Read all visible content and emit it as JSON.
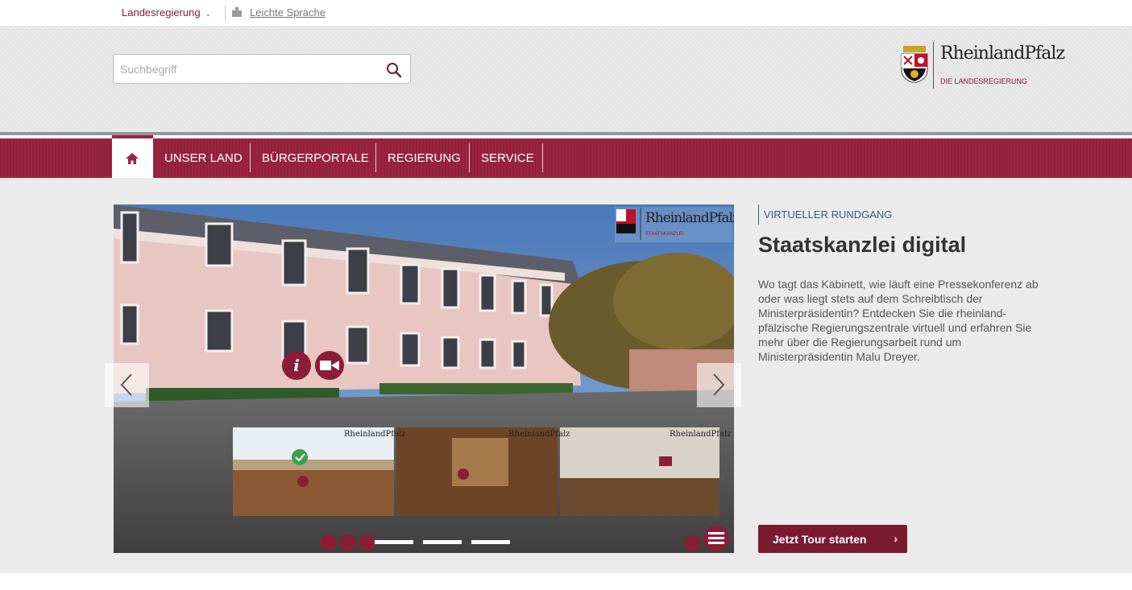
{
  "topbar": {
    "landesregierung_label": "Landesregierung",
    "leichte_sprache_label": "Leichte Sprache"
  },
  "search": {
    "placeholder": "Suchbegriff"
  },
  "logo": {
    "name": "RheinlandPfalz",
    "subtitle": "DIE LANDESREGIERUNG"
  },
  "nav": {
    "items": [
      {
        "label": "UNSER LAND"
      },
      {
        "label": "BÜRGERPORTALE"
      },
      {
        "label": "REGIERUNG"
      },
      {
        "label": "SERVICE"
      }
    ]
  },
  "slider": {
    "image_logo_name": "RheinlandPfalz",
    "image_logo_sub": "STAATSKANZLEI",
    "thumb_logo": "RheinlandPfalz",
    "active_indicator": 0
  },
  "feature": {
    "category": "VIRTUELLER RUNDGANG",
    "title": "Staatskanzlei digital",
    "text": "Wo tagt das Kabinett, wie läuft eine Pressekonferenz ab oder was liegt stets auf dem Schreibtisch der Ministerpräsidentin? Entdecken Sie die rheinland-pfälzische Regierungszentrale virtuell und erfahren Sie mehr über die Regierungsarbeit rund um Ministerpräsidentin Malu Dreyer.",
    "cta_label": "Jetzt Tour starten",
    "cta_chevron": "›"
  },
  "colors": {
    "brand": "#9b2640",
    "cta": "#7a1b32",
    "category": "#335f85"
  }
}
